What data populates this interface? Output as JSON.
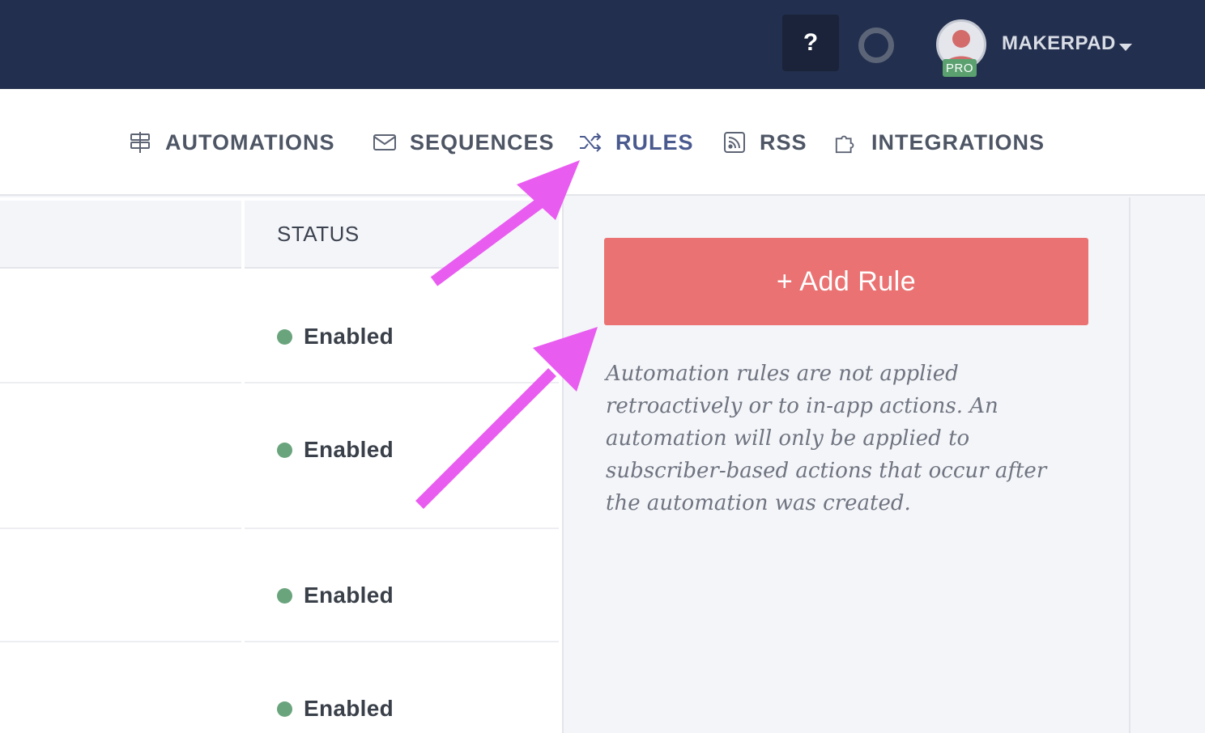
{
  "topbar": {
    "help_label": "?",
    "account_name": "MAKERPAD",
    "pro_badge": "PRO"
  },
  "subnav": {
    "items": [
      {
        "label": "AUTOMATIONS",
        "icon": "signpost-icon",
        "active": false
      },
      {
        "label": "SEQUENCES",
        "icon": "envelope-icon",
        "active": false
      },
      {
        "label": "RULES",
        "icon": "shuffle-icon",
        "active": true
      },
      {
        "label": "RSS",
        "icon": "rss-icon",
        "active": false
      },
      {
        "label": "INTEGRATIONS",
        "icon": "puzzle-icon",
        "active": false
      }
    ]
  },
  "table": {
    "status_header": "STATUS",
    "rows": [
      {
        "status": "Enabled"
      },
      {
        "status": "Enabled"
      },
      {
        "status": "Enabled"
      },
      {
        "status": "Enabled"
      }
    ]
  },
  "side_panel": {
    "add_rule_label": "+ Add Rule",
    "help_text": "Automation rules are not applied retroactively or to in-app actions. An automation will only be applied to subscriber-based actions that occur after the automation was created."
  },
  "colors": {
    "navbar": "#232f4e",
    "accent_button": "#ea7272",
    "status_enabled": "#6aa47d",
    "annotation_arrow": "#e95cf0",
    "active_tab": "#4a5a8f"
  }
}
